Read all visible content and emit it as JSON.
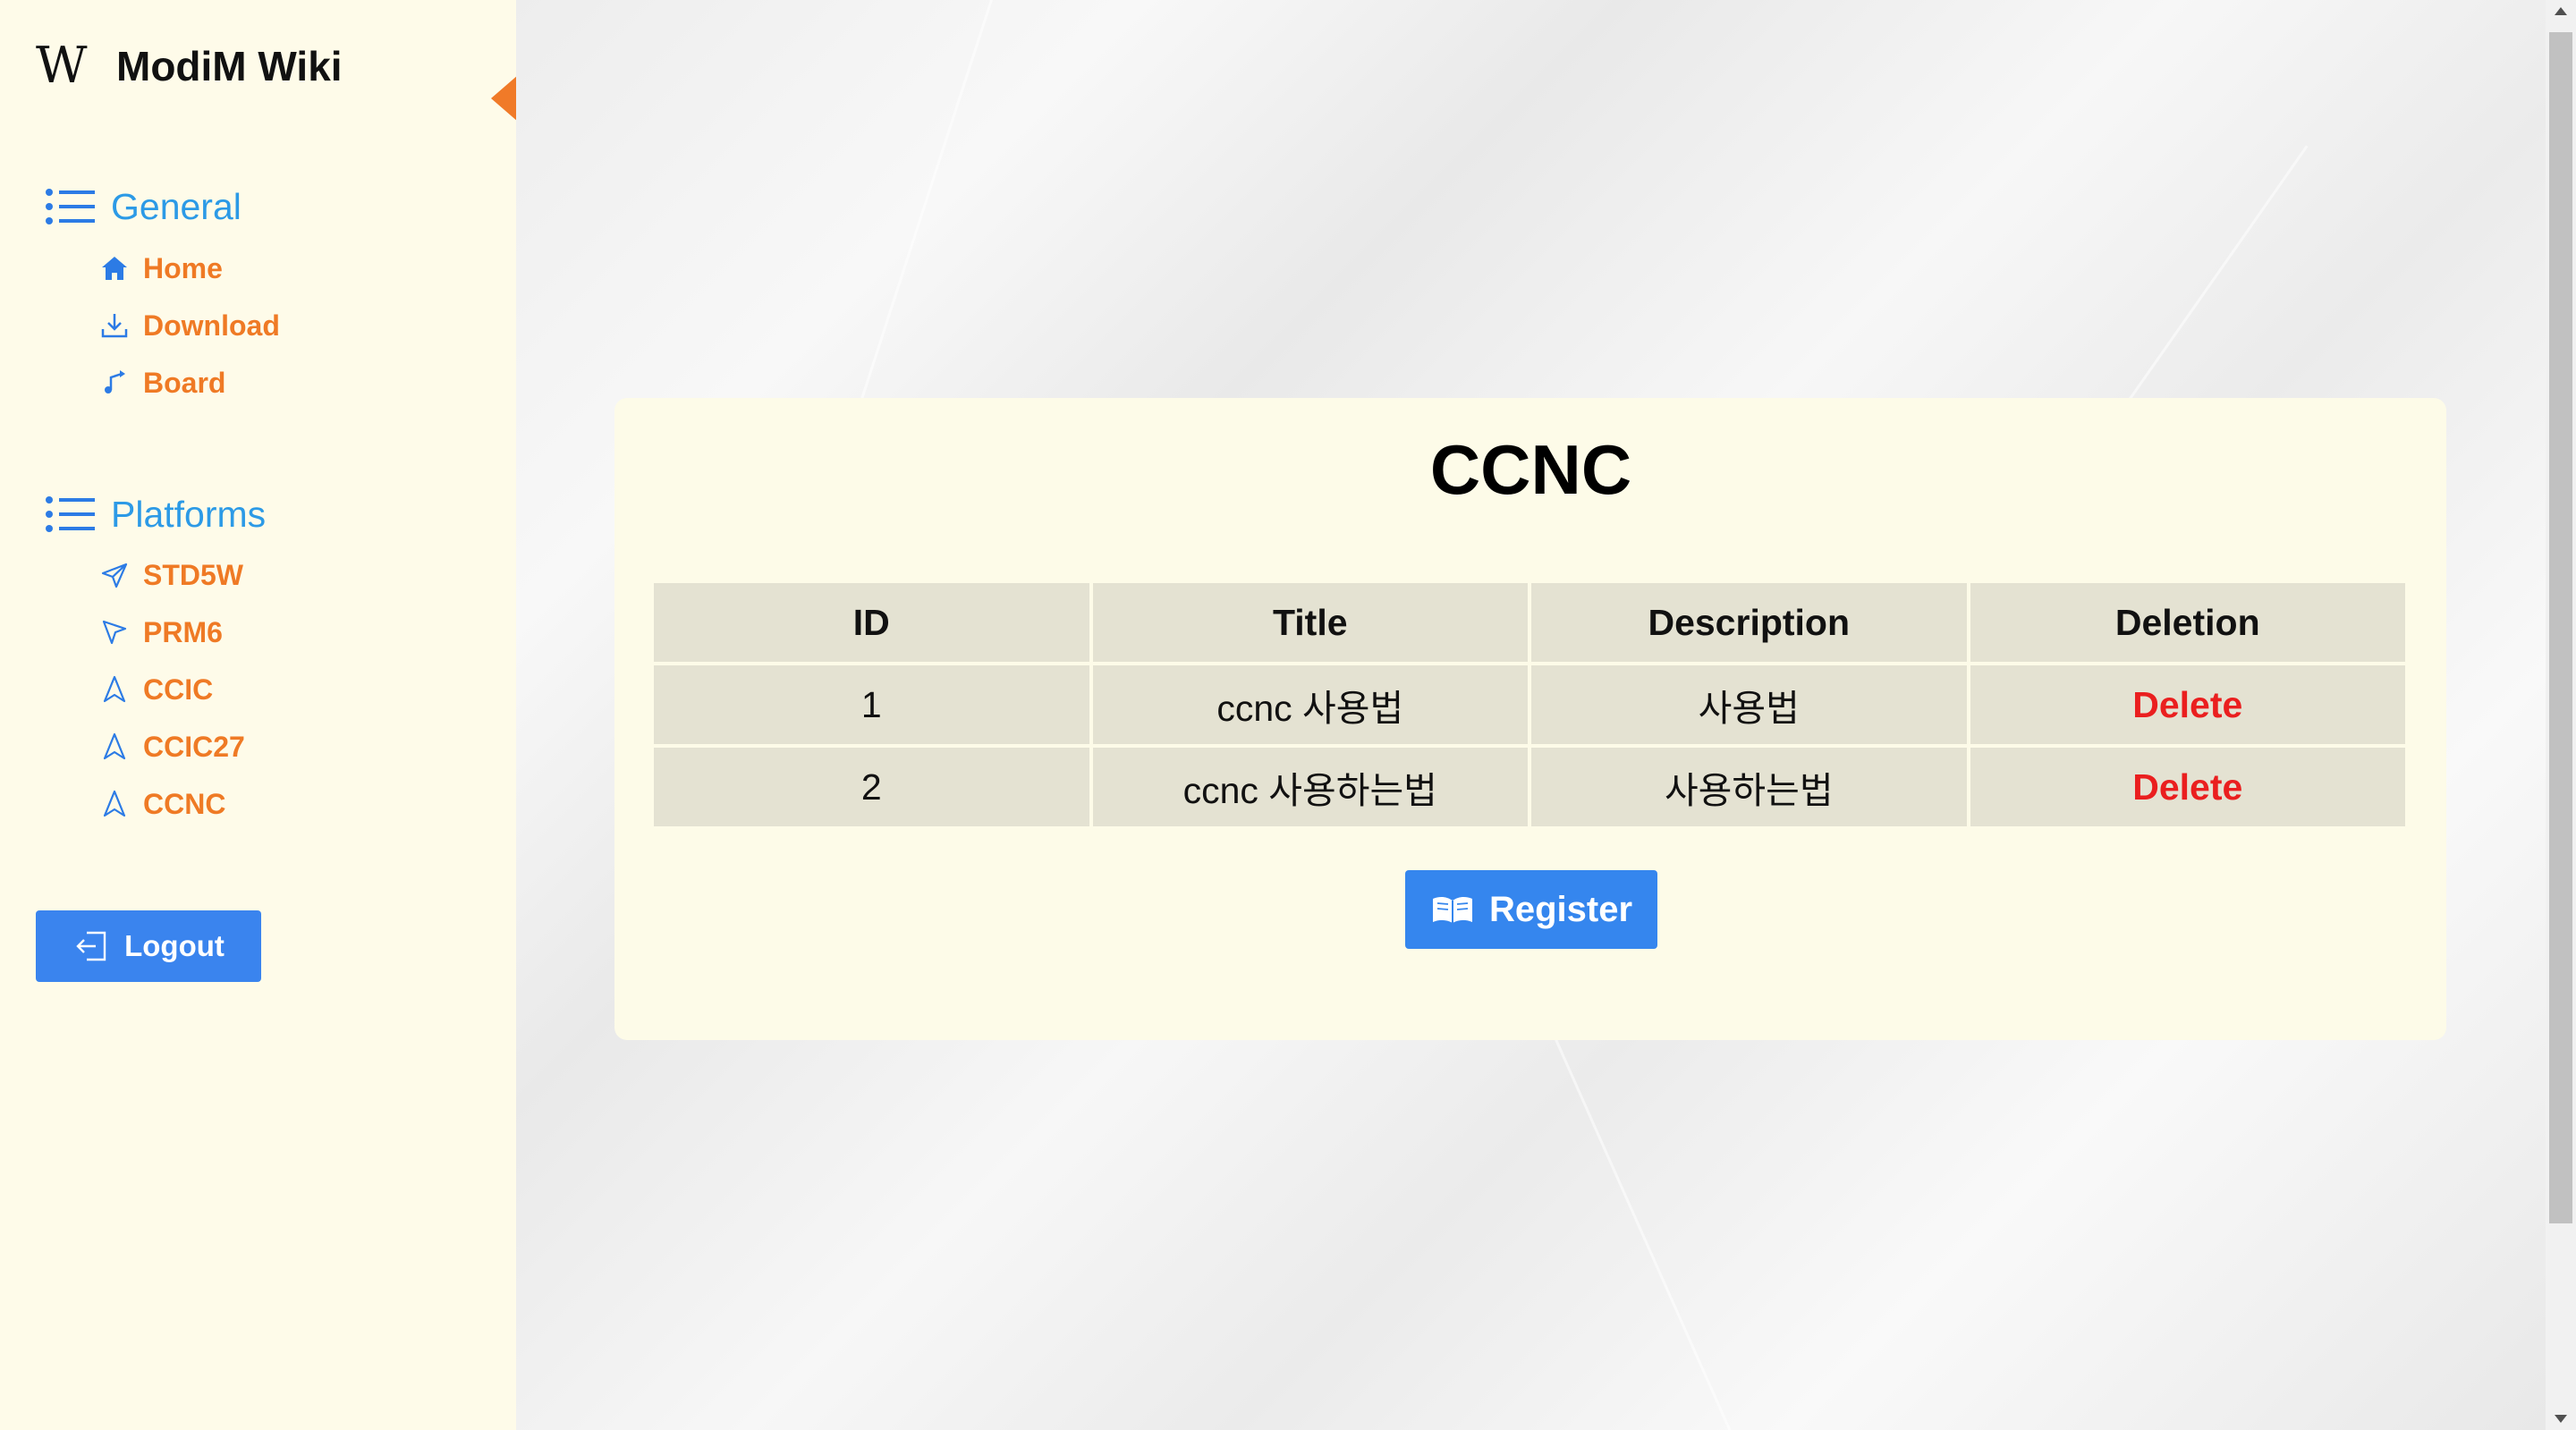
{
  "brand": {
    "logo": "W",
    "name": "ModiM Wiki"
  },
  "sidebar": {
    "sections": [
      {
        "title": "General",
        "icon": "list-icon",
        "items": [
          {
            "label": "Home",
            "icon": "home-icon"
          },
          {
            "label": "Download",
            "icon": "download-icon"
          },
          {
            "label": "Board",
            "icon": "board-icon"
          }
        ]
      },
      {
        "title": "Platforms",
        "icon": "list-icon",
        "items": [
          {
            "label": "STD5W",
            "icon": "send-icon"
          },
          {
            "label": "PRM6",
            "icon": "cursor-icon"
          },
          {
            "label": "CCIC",
            "icon": "navigation-icon"
          },
          {
            "label": "CCIC27",
            "icon": "navigation-icon"
          },
          {
            "label": "CCNC",
            "icon": "navigation-icon"
          }
        ]
      }
    ],
    "logout_label": "Logout"
  },
  "main": {
    "title": "CCNC",
    "table": {
      "headers": [
        "ID",
        "Title",
        "Description",
        "Deletion"
      ],
      "rows": [
        {
          "id": "1",
          "title": "ccnc 사용법",
          "description": "사용법",
          "action": "Delete"
        },
        {
          "id": "2",
          "title": "ccnc 사용하는법",
          "description": "사용하는법",
          "action": "Delete"
        }
      ]
    },
    "register_label": "Register"
  },
  "colors": {
    "sidebar_bg": "#fefbe9",
    "section_title": "#2c9ae6",
    "nav_label": "#ef7a25",
    "button_blue": "#3a84ee",
    "delete_red": "#ea1f1f",
    "card_bg": "#fdfbe8",
    "table_cell": "#e4e2d2"
  }
}
